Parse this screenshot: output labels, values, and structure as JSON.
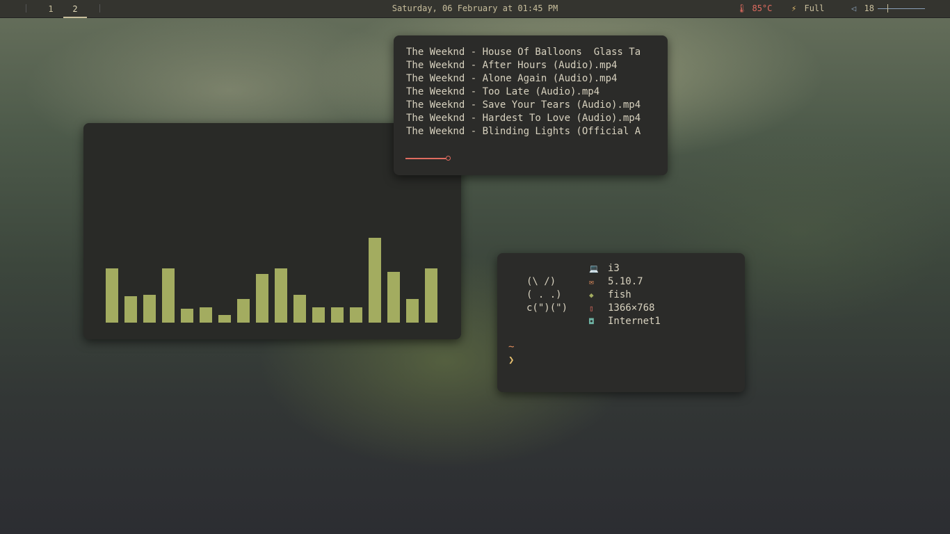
{
  "bar": {
    "workspaces": [
      {
        "label": "1",
        "active": false
      },
      {
        "label": "2",
        "active": true
      }
    ],
    "clock": "Saturday, 06 February at 01:45 PM",
    "temperature": "85°C",
    "battery": "Full",
    "volume": "18",
    "volume_level_fraction": 0.2,
    "icons": {
      "temperature": "thermometer-icon",
      "battery": "battery-charging-icon",
      "volume": "speaker-icon"
    }
  },
  "player": {
    "tracks": [
      "The Weeknd - House Of Balloons  Glass Ta",
      "The Weeknd - After Hours (Audio).mp4",
      "The Weeknd - Alone Again (Audio).mp4",
      "The Weeknd - Too Late (Audio).mp4",
      "The Weeknd - Save Your Tears (Audio).mp4",
      "The Weeknd - Hardest To Love (Audio).mp4",
      "The Weeknd - Blinding Lights (Official A"
    ],
    "progress_fraction": 0.16,
    "progress_color": "#e06c60"
  },
  "visualizer": {
    "bar_color": "#a3ac60",
    "levels": [
      0.64,
      0.31,
      0.33,
      0.64,
      0.16,
      0.18,
      0.09,
      0.28,
      0.57,
      0.64,
      0.33,
      0.18,
      0.18,
      0.18,
      1.0,
      0.6,
      0.28,
      0.64
    ]
  },
  "terminal": {
    "ascii": [
      "(\\ /)",
      "( . .)",
      "c(\")(\")"
    ],
    "info": [
      {
        "icon": "laptop-icon",
        "value": "i3"
      },
      {
        "icon": "mail-icon",
        "value": "5.10.7"
      },
      {
        "icon": "fish-icon",
        "value": "fish"
      },
      {
        "icon": "phone-icon",
        "value": "1366×768"
      },
      {
        "icon": "network-icon",
        "value": "Internet1"
      }
    ],
    "prompt_dir": "~",
    "prompt_symbol": "❯"
  }
}
